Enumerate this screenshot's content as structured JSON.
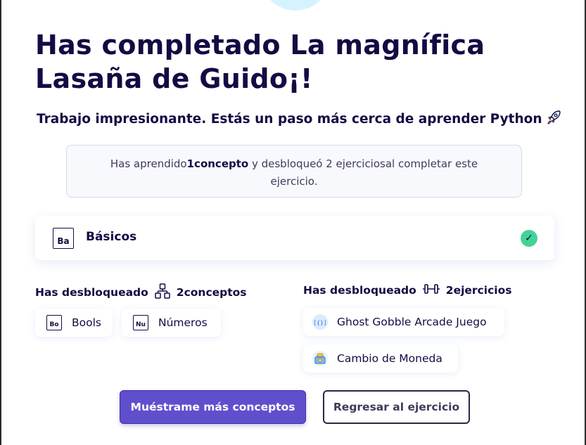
{
  "header": {
    "title": "Has completado La magnífica Lasaña de Guido¡!",
    "subtitle": "Trabajo impresionante. Estás un paso más cerca de aprender Python"
  },
  "summary": {
    "prefix": "Has aprendido",
    "concept_count": "1",
    "concept_word": "concepto",
    "middle": " y desbloqueó 2 ejercicios",
    "suffix": "al completar este ejercicio."
  },
  "learned_concept": {
    "abbr": "Ba",
    "name": "Básicos"
  },
  "unlocked_concepts": {
    "label": "Has desbloqueado",
    "count_text": "2conceptos",
    "items": [
      {
        "abbr": "Bo",
        "name": "Bools"
      },
      {
        "abbr": "Nu",
        "name": "Números"
      }
    ]
  },
  "unlocked_exercises": {
    "label": "Has desbloqueado",
    "count_text": "2ejercicios",
    "items": [
      {
        "name": "Ghost Gobble Arcade Juego",
        "icon": "ghost-gobble-icon"
      },
      {
        "name": "Cambio de Moneda",
        "icon": "currency-exchange-icon"
      }
    ]
  },
  "actions": {
    "primary_label": "Muéstrame más conceptos",
    "secondary_label": "Regresar al ejercicio"
  },
  "colors": {
    "primary": "#604fcd",
    "text": "#130b43",
    "success": "#43d297"
  }
}
